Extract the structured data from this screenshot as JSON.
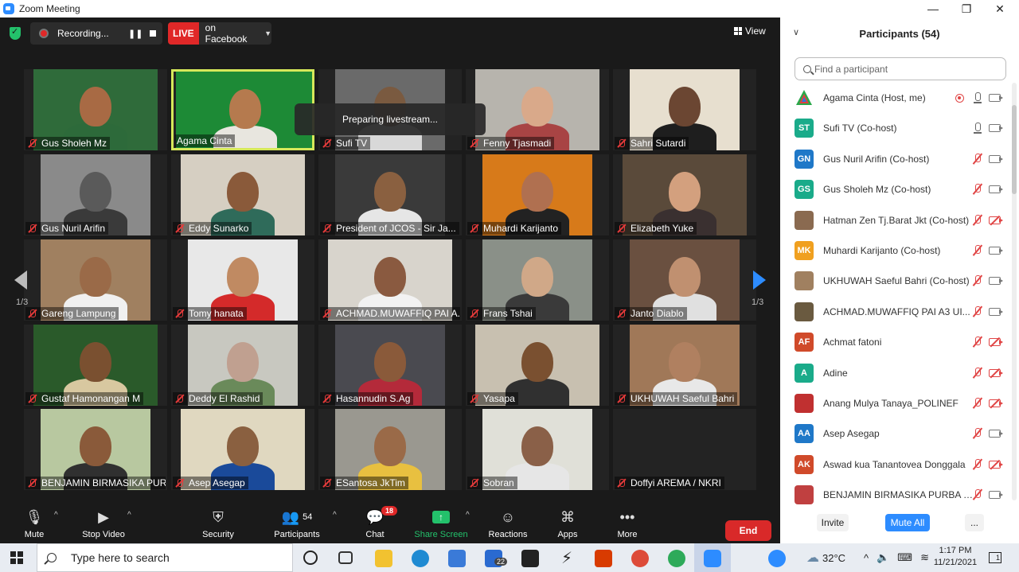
{
  "window": {
    "title": "Zoom Meeting",
    "minimize": "—",
    "restore": "❐",
    "close": "✕"
  },
  "topbar": {
    "recording_label": "Recording...",
    "live_badge": "LIVE",
    "live_target": "on Facebook",
    "view_label": "View"
  },
  "overlay": {
    "message": "Preparing livestream..."
  },
  "pagination": {
    "left": "1/3",
    "right": "1/3"
  },
  "tiles": [
    {
      "name": "Gus Sholeh Mz",
      "bg": "#2f6b3a",
      "skin": "#a86a44",
      "shirt": "#2d6a3a"
    },
    {
      "name": "Agama Cinta",
      "bg": "#1d8a36",
      "skin": "#b57a4e",
      "shirt": "#e8e6df"
    },
    {
      "name": "Sufi TV",
      "bg": "#6a6a6a",
      "skin": "#7a5a40",
      "shirt": "#d8d8d8"
    },
    {
      "name": "Fenny Tjasmadi",
      "bg": "#b7b4ad",
      "skin": "#d9a98a",
      "shirt": "#a84444"
    },
    {
      "name": "Sahri Sutardi",
      "bg": "#e7dfcf",
      "skin": "#6b4632",
      "shirt": "#1e1e1e"
    },
    {
      "name": "Gus Nuril Arifin",
      "bg": "#8a8a8a",
      "skin": "#5a5a5a",
      "shirt": "#3a3a3a"
    },
    {
      "name": "Eddy Sunarko",
      "bg": "#d6cfc2",
      "skin": "#8a5a3a",
      "shirt": "#2f6b5a"
    },
    {
      "name": "President of JCOS - Sir Ja...",
      "bg": "#3a3a3a",
      "skin": "#8a6040",
      "shirt": "#e6e6e6"
    },
    {
      "name": "Muhardi Karijanto",
      "bg": "#d77a1a",
      "skin": "#b07050",
      "shirt": "#222222"
    },
    {
      "name": "Elizabeth Yuke",
      "bg": "#5a4a3a",
      "skin": "#d3a07e",
      "shirt": "#3a3030"
    },
    {
      "name": "Gareng Lampung",
      "bg": "#a08060",
      "skin": "#9a6a48",
      "shirt": "#f0f0f0"
    },
    {
      "name": "Tomy hanata",
      "bg": "#e8e8e8",
      "skin": "#c08a62",
      "shirt": "#d42a2a"
    },
    {
      "name": "ACHMAD.MUWAFFIQ PAI A...",
      "bg": "#d8d4cc",
      "skin": "#8a5a40",
      "shirt": "#f2f2f2"
    },
    {
      "name": "Frans Tshai",
      "bg": "#8a9088",
      "skin": "#d0a888",
      "shirt": "#3a3a3a"
    },
    {
      "name": "Janto Diablo",
      "bg": "#6a5040",
      "skin": "#c09070",
      "shirt": "#e0e0e0"
    },
    {
      "name": "Gustaf Hamonangan M",
      "bg": "#2a5a2a",
      "skin": "#7a5030",
      "shirt": "#d8c8a0"
    },
    {
      "name": "Deddy El Rashid",
      "bg": "#c8c8c0",
      "skin": "#c0a090",
      "shirt": "#6a8a5a"
    },
    {
      "name": "Hasannudin S.Ag",
      "bg": "#4a4a50",
      "skin": "#8a5a3a",
      "shirt": "#b42a3a"
    },
    {
      "name": "Yasapa",
      "bg": "#c8c0b0",
      "skin": "#7a5030",
      "shirt": "#303030"
    },
    {
      "name": "UKHUWAH Saeful Bahri",
      "bg": "#a07858",
      "skin": "#b08060",
      "shirt": "#e8e8e8"
    },
    {
      "name": "BENJAMIN BIRMASIKA PUR...",
      "bg": "#b8c8a0",
      "skin": "#8a5a3a",
      "shirt": "#303030"
    },
    {
      "name": "Asep Asegap",
      "bg": "#e0d8c0",
      "skin": "#8a6040",
      "shirt": "#1a4a9a"
    },
    {
      "name": "ESantosa JkTim",
      "bg": "#9a9890",
      "skin": "#9a6a48",
      "shirt": "#e8c040"
    },
    {
      "name": "Sobran",
      "bg": "#e0e0d8",
      "skin": "#8a6048",
      "shirt": "#e6e6e6"
    },
    {
      "name": "Doffyi AREMA / NKRI",
      "bg": "#232323",
      "skin": "",
      "shirt": ""
    }
  ],
  "toolbar": {
    "mute": "Mute",
    "stop_video": "Stop Video",
    "security": "Security",
    "participants": "Participants",
    "participants_count": "54",
    "chat": "Chat",
    "chat_badge": "18",
    "share_screen": "Share Screen",
    "reactions": "Reactions",
    "apps": "Apps",
    "more": "More",
    "end": "End"
  },
  "panel": {
    "title": "Participants (54)",
    "search_placeholder": "Find a participant",
    "participants": [
      {
        "name": "Agama Cinta (Host, me)",
        "initials": "",
        "color": "#ffffff",
        "mic": "on",
        "cam": "on",
        "rec": true
      },
      {
        "name": "Sufi TV (Co-host)",
        "initials": "ST",
        "color": "#1aab8a",
        "mic": "on",
        "cam": "on",
        "rec": false
      },
      {
        "name": "Gus Nuril Arifin (Co-host)",
        "initials": "GN",
        "color": "#1f78c8",
        "mic": "off",
        "cam": "on",
        "rec": false
      },
      {
        "name": "Gus Sholeh Mz (Co-host)",
        "initials": "GS",
        "color": "#1aab8a",
        "mic": "off",
        "cam": "on",
        "rec": false
      },
      {
        "name": "Hatman Zen Tj.Barat Jkt (Co-host)",
        "initials": "",
        "color": "#8a6a50",
        "mic": "off",
        "cam": "off",
        "rec": false
      },
      {
        "name": "Muhardi Karijanto (Co-host)",
        "initials": "MK",
        "color": "#f0a020",
        "mic": "off",
        "cam": "on",
        "rec": false
      },
      {
        "name": "UKHUWAH Saeful Bahri (Co-host)",
        "initials": "",
        "color": "#a08060",
        "mic": "off",
        "cam": "on",
        "rec": false
      },
      {
        "name": "ACHMAD.MUWAFFIQ PAI A3 UI...",
        "initials": "",
        "color": "#6a5a40",
        "mic": "off",
        "cam": "on",
        "rec": false
      },
      {
        "name": "Achmat fatoni",
        "initials": "AF",
        "color": "#d04a2a",
        "mic": "off",
        "cam": "off",
        "rec": false
      },
      {
        "name": "Adine",
        "initials": "A",
        "color": "#1aab8a",
        "mic": "off",
        "cam": "off",
        "rec": false
      },
      {
        "name": "Anang Mulya Tanaya_POLINEF",
        "initials": "",
        "color": "#c03030",
        "mic": "off",
        "cam": "off",
        "rec": false
      },
      {
        "name": "Asep Asegap",
        "initials": "AA",
        "color": "#1f78c8",
        "mic": "off",
        "cam": "on",
        "rec": false
      },
      {
        "name": "Aswad kua Tanantovea Donggala",
        "initials": "AK",
        "color": "#d04a2a",
        "mic": "off",
        "cam": "off",
        "rec": false
      },
      {
        "name": "BENJAMIN BIRMASIKA PURBA - ...",
        "initials": "",
        "color": "#c04040",
        "mic": "off",
        "cam": "on",
        "rec": false
      }
    ],
    "invite": "Invite",
    "mute_all": "Mute All",
    "more": "..."
  },
  "taskbar": {
    "search_placeholder": "Type here to search",
    "mail_badge": "22",
    "temperature": "32°C",
    "time": "1:17 PM",
    "date": "11/21/2021",
    "notifications": "1"
  }
}
